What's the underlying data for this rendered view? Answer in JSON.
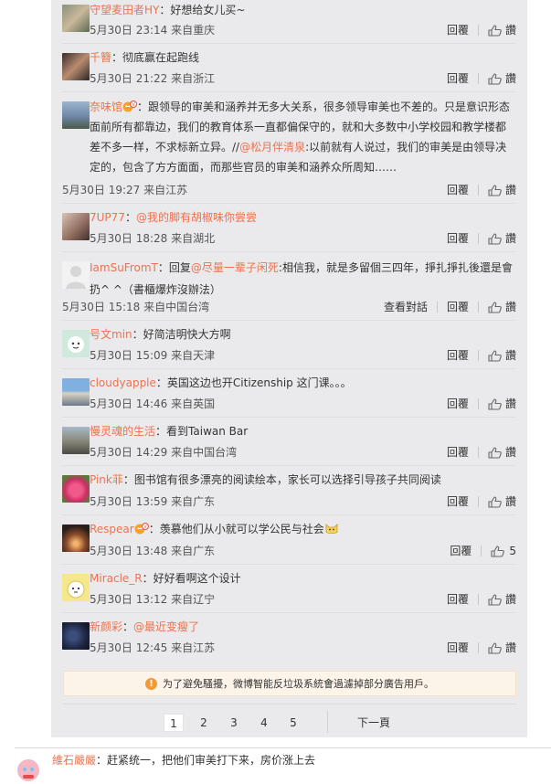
{
  "labels": {
    "reply": "回覆",
    "like": "讚",
    "view_conversation": "查看對話"
  },
  "comments": [
    {
      "user": "守望麦田者HY",
      "sep": "：",
      "body": "好想给女儿买~",
      "time": "5月30日 23:14",
      "source": "来自重庆",
      "likes": ""
    },
    {
      "user": "千簪",
      "sep": "：",
      "body": "彻底赢在起跑线",
      "time": "5月30日 21:22",
      "source": "来自浙江",
      "likes": ""
    },
    {
      "user": "奈味馆",
      "sep": "：",
      "body_a": "跟领导的审美和涵养并无多大关系，很多领导审美也不差的。只是意识形态面前所有都靠边，我们的教育体系一直都偏保守的，就和大多数中小学校园和教学楼都差不多一样，不求标新立异。//",
      "mention": "@松月伴清泉",
      "body_b": ":以前就有人说过，我们的审美是由领导决定的，包含了方方面面，而那些官员的审美和涵养众所周知……",
      "time": "5月30日 19:27",
      "source": "来自江苏",
      "likes": ""
    },
    {
      "user": "7UP77",
      "sep": "：",
      "mention": "@我的脚有胡椒味你尝尝",
      "time": "5月30日 18:28",
      "source": "来自湖北",
      "likes": ""
    },
    {
      "user": "IamSuFromT",
      "sep": "：",
      "body_a": "回复",
      "mention": "@尽量一辈子闲死",
      "body_b": ":相信我，就是多留個三四年，掙扎掙扎後還是會扔^ ^（書櫃爆炸沒辦法）",
      "time": "5月30日 15:18",
      "source": "来自中国台湾",
      "likes": ""
    },
    {
      "user": "号文min",
      "sep": "：",
      "body": "好简洁明快大方啊",
      "time": "5月30日 15:09",
      "source": "来自天津",
      "likes": ""
    },
    {
      "user": "cloudyapple",
      "sep": "：",
      "body": "英国这边也开Citizenship 这门课。。。",
      "time": "5月30日 14:46",
      "source": "来自英国",
      "likes": ""
    },
    {
      "user": "慢灵魂的生活",
      "sep": "：",
      "body": "看到Taiwan Bar",
      "time": "5月30日 14:29",
      "source": "来自中国台湾",
      "likes": ""
    },
    {
      "user": "Pink菲",
      "sep": "：",
      "body": "图书馆有很多漂亮的阅读绘本，家长可以选择引导孩子共同阅读",
      "time": "5月30日 13:59",
      "source": "来自广东",
      "likes": ""
    },
    {
      "user": "Respear",
      "sep": "：",
      "body": "羡慕他们从小就可以学公民与社会",
      "time": "5月30日 13:48",
      "source": "来自广东",
      "likes": "5"
    },
    {
      "user": "Miracle_R",
      "sep": "：",
      "body": "好好看啊这个设计",
      "time": "5月30日 13:12",
      "source": "来自辽宁",
      "likes": ""
    },
    {
      "user": "新颜彩",
      "sep": "：",
      "mention": "@最近变瘦了",
      "time": "5月30日 12:45",
      "source": "来自江苏",
      "likes": ""
    }
  ],
  "notice": "为了避免騷擾，微博智能反垃圾系統會過濾掉部分廣告用戶。",
  "pagination": {
    "pages": [
      "1",
      "2",
      "3",
      "4",
      "5"
    ],
    "current": "1",
    "next": "下一頁"
  },
  "outer_comment": {
    "user": "維石嚴嚴",
    "sep": "：",
    "body": "赶紧统一，把他们审美打下来，房价涨上去"
  },
  "colors": {
    "accent": "#eb7350",
    "panel": "#eaeaec",
    "notice_bg": "#fdf4e9",
    "warning": "#f29a37"
  }
}
